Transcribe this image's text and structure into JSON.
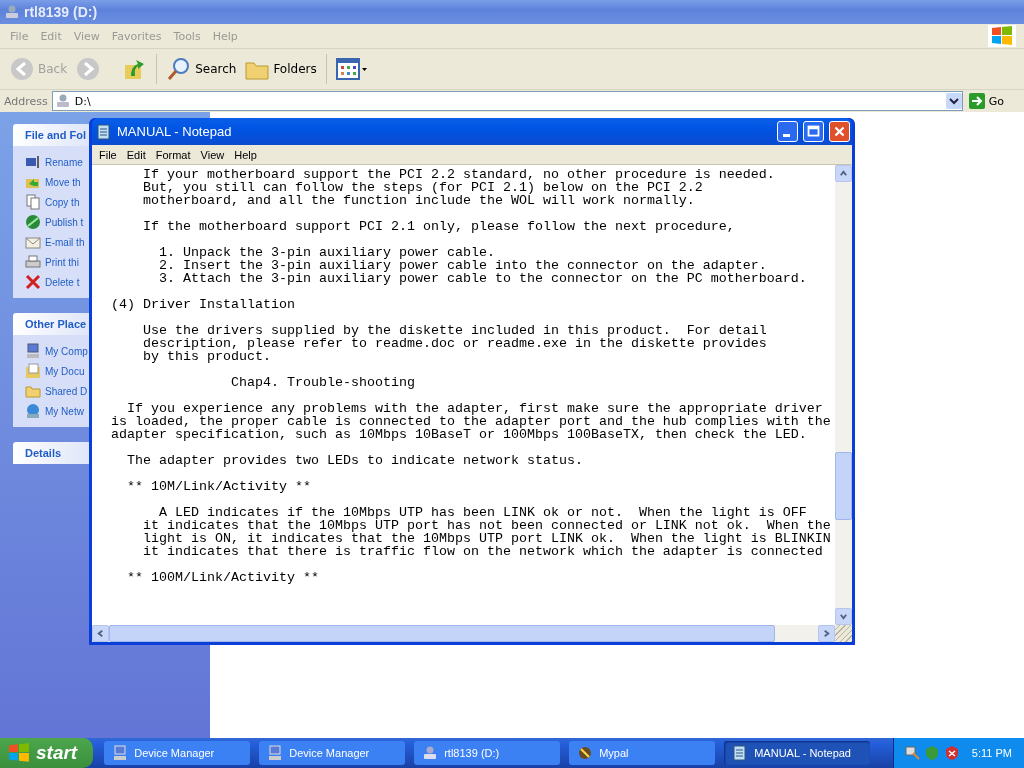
{
  "explorer": {
    "title": "rtl8139 (D:)",
    "menu": [
      "File",
      "Edit",
      "View",
      "Favorites",
      "Tools",
      "Help"
    ],
    "toolbar": [
      {
        "kind": "back",
        "label": "Back",
        "disabled": true
      },
      {
        "kind": "forward",
        "disabled": true
      },
      {
        "kind": "up",
        "disabled": false
      },
      {
        "kind": "search",
        "label": "Search",
        "disabled": false
      },
      {
        "kind": "folders",
        "label": "Folders",
        "disabled": false
      },
      {
        "kind": "views"
      }
    ],
    "address": {
      "label": "Address",
      "value": "D:\\",
      "go": "Go"
    },
    "task_panes": [
      {
        "title": "File and Fol",
        "items": [
          "Rename",
          "Move th",
          "Copy th",
          "Publish t",
          "E-mail th",
          "Print thi",
          "Delete t"
        ]
      },
      {
        "title": "Other Place",
        "items": [
          "My Comp",
          "My Docu",
          "Shared D",
          "My Netw"
        ]
      },
      {
        "title": "Details"
      }
    ]
  },
  "notepad": {
    "title": "MANUAL - Notepad",
    "menu": [
      "File",
      "Edit",
      "Format",
      "View",
      "Help"
    ],
    "blocks": [
      {
        "kind": "text",
        "lines": [
          "    If your motherboard support the PCI 2.2 standard, no other procedure is needed.",
          "    But, you still can follow the steps (for PCI 2.1) below on the PCI 2.2",
          "    motherboard, and all the function include the WOL will work normally."
        ]
      },
      {
        "kind": "text",
        "lines": [
          "    If the motherboard support PCI 2.1 only, please follow the next procedure,"
        ]
      },
      {
        "kind": "text",
        "lines": [
          "      1. Unpack the 3-pin auxiliary power cable.",
          "      2. Insert the 3-pin auxiliary power cable into the connector on the adapter.",
          "      3. Attach the 3-pin auxiliary power cable to the connector on the PC motherboard."
        ]
      },
      {
        "kind": "text",
        "lines": [
          "(4) Driver Installation"
        ]
      },
      {
        "kind": "text",
        "lines": [
          "    Use the drivers supplied by the diskette included in this product.  For detail",
          "    description, please refer to readme.doc or readme.exe in the diskette provides",
          "    by this product."
        ]
      },
      {
        "kind": "heading",
        "lines": [
          "               Chap4. Trouble-shooting"
        ]
      },
      {
        "kind": "text",
        "lines": [
          "  If you experience any problems with the adapter, first make sure the appropriate driver",
          "is loaded, the proper cable is connected to the adapter port and the hub complies with the",
          "adapter specification, such as 10Mbps 10BaseT or 100Mbps 100BaseTX, then check the LED."
        ]
      },
      {
        "kind": "text",
        "lines": [
          "  The adapter provides two LEDs to indicate network status."
        ]
      },
      {
        "kind": "text",
        "lines": [
          "  ** 10M/Link/Activity **"
        ]
      },
      {
        "kind": "text",
        "lines": [
          "      A LED indicates if the 10Mbps UTP has been LINK ok or not.  When the light is OFF",
          "    it indicates that the 10Mbps UTP port has not been connected or LINK not ok.  When the",
          "    light is ON, it indicates that the 10Mbps UTP port LINK ok.  When the light is BLINKIN",
          "    it indicates that there is traffic flow on the network which the adapter is connected"
        ]
      },
      {
        "kind": "text",
        "lines": [
          "  ** 100M/Link/Activity **"
        ]
      }
    ]
  },
  "taskbar": {
    "start": "start",
    "tasks": [
      {
        "label": "Device Manager",
        "selected": false
      },
      {
        "label": "Device Manager",
        "selected": false
      },
      {
        "label": "rtl8139 (D:)",
        "selected": false
      },
      {
        "label": "Mypal",
        "selected": false
      },
      {
        "label": "MANUAL - Notepad",
        "selected": true
      }
    ],
    "clock": "5:11 PM"
  }
}
